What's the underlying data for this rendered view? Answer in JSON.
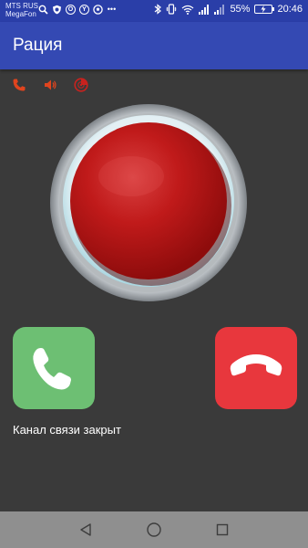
{
  "status_bar": {
    "carrier_1": "MTS RUS",
    "carrier_2": "MegaFon",
    "battery_percent": "55%",
    "time": "20:46",
    "icons": [
      "search-icon",
      "shield-icon",
      "opera-icon",
      "yandex-icon",
      "soccer-ball-icon",
      "notification-dots-icon",
      "bluetooth-icon",
      "vibrate-icon",
      "wifi-icon",
      "signal-icon",
      "signal-icon",
      "battery-icon"
    ]
  },
  "app_bar": {
    "title": "Рация"
  },
  "toolbar_icons": [
    "phone-icon",
    "speaker-icon",
    "radar-icon"
  ],
  "main": {
    "push_to_talk": "push-to-talk-button",
    "answer_button": "answer-call-button",
    "hangup_button": "hangup-call-button",
    "status": "Канал связи закрыт"
  },
  "colors": {
    "status_bar": "#2a3ea8",
    "app_bar": "#3449b3",
    "background": "#3a3a3a",
    "accent_red": "#e8373d",
    "answer_green": "#6dbf73",
    "icon_orange": "#e0441e",
    "nav_bar": "#8f8f8f"
  },
  "nav_bar": {
    "buttons": [
      "back-icon",
      "home-icon",
      "recents-icon"
    ]
  }
}
